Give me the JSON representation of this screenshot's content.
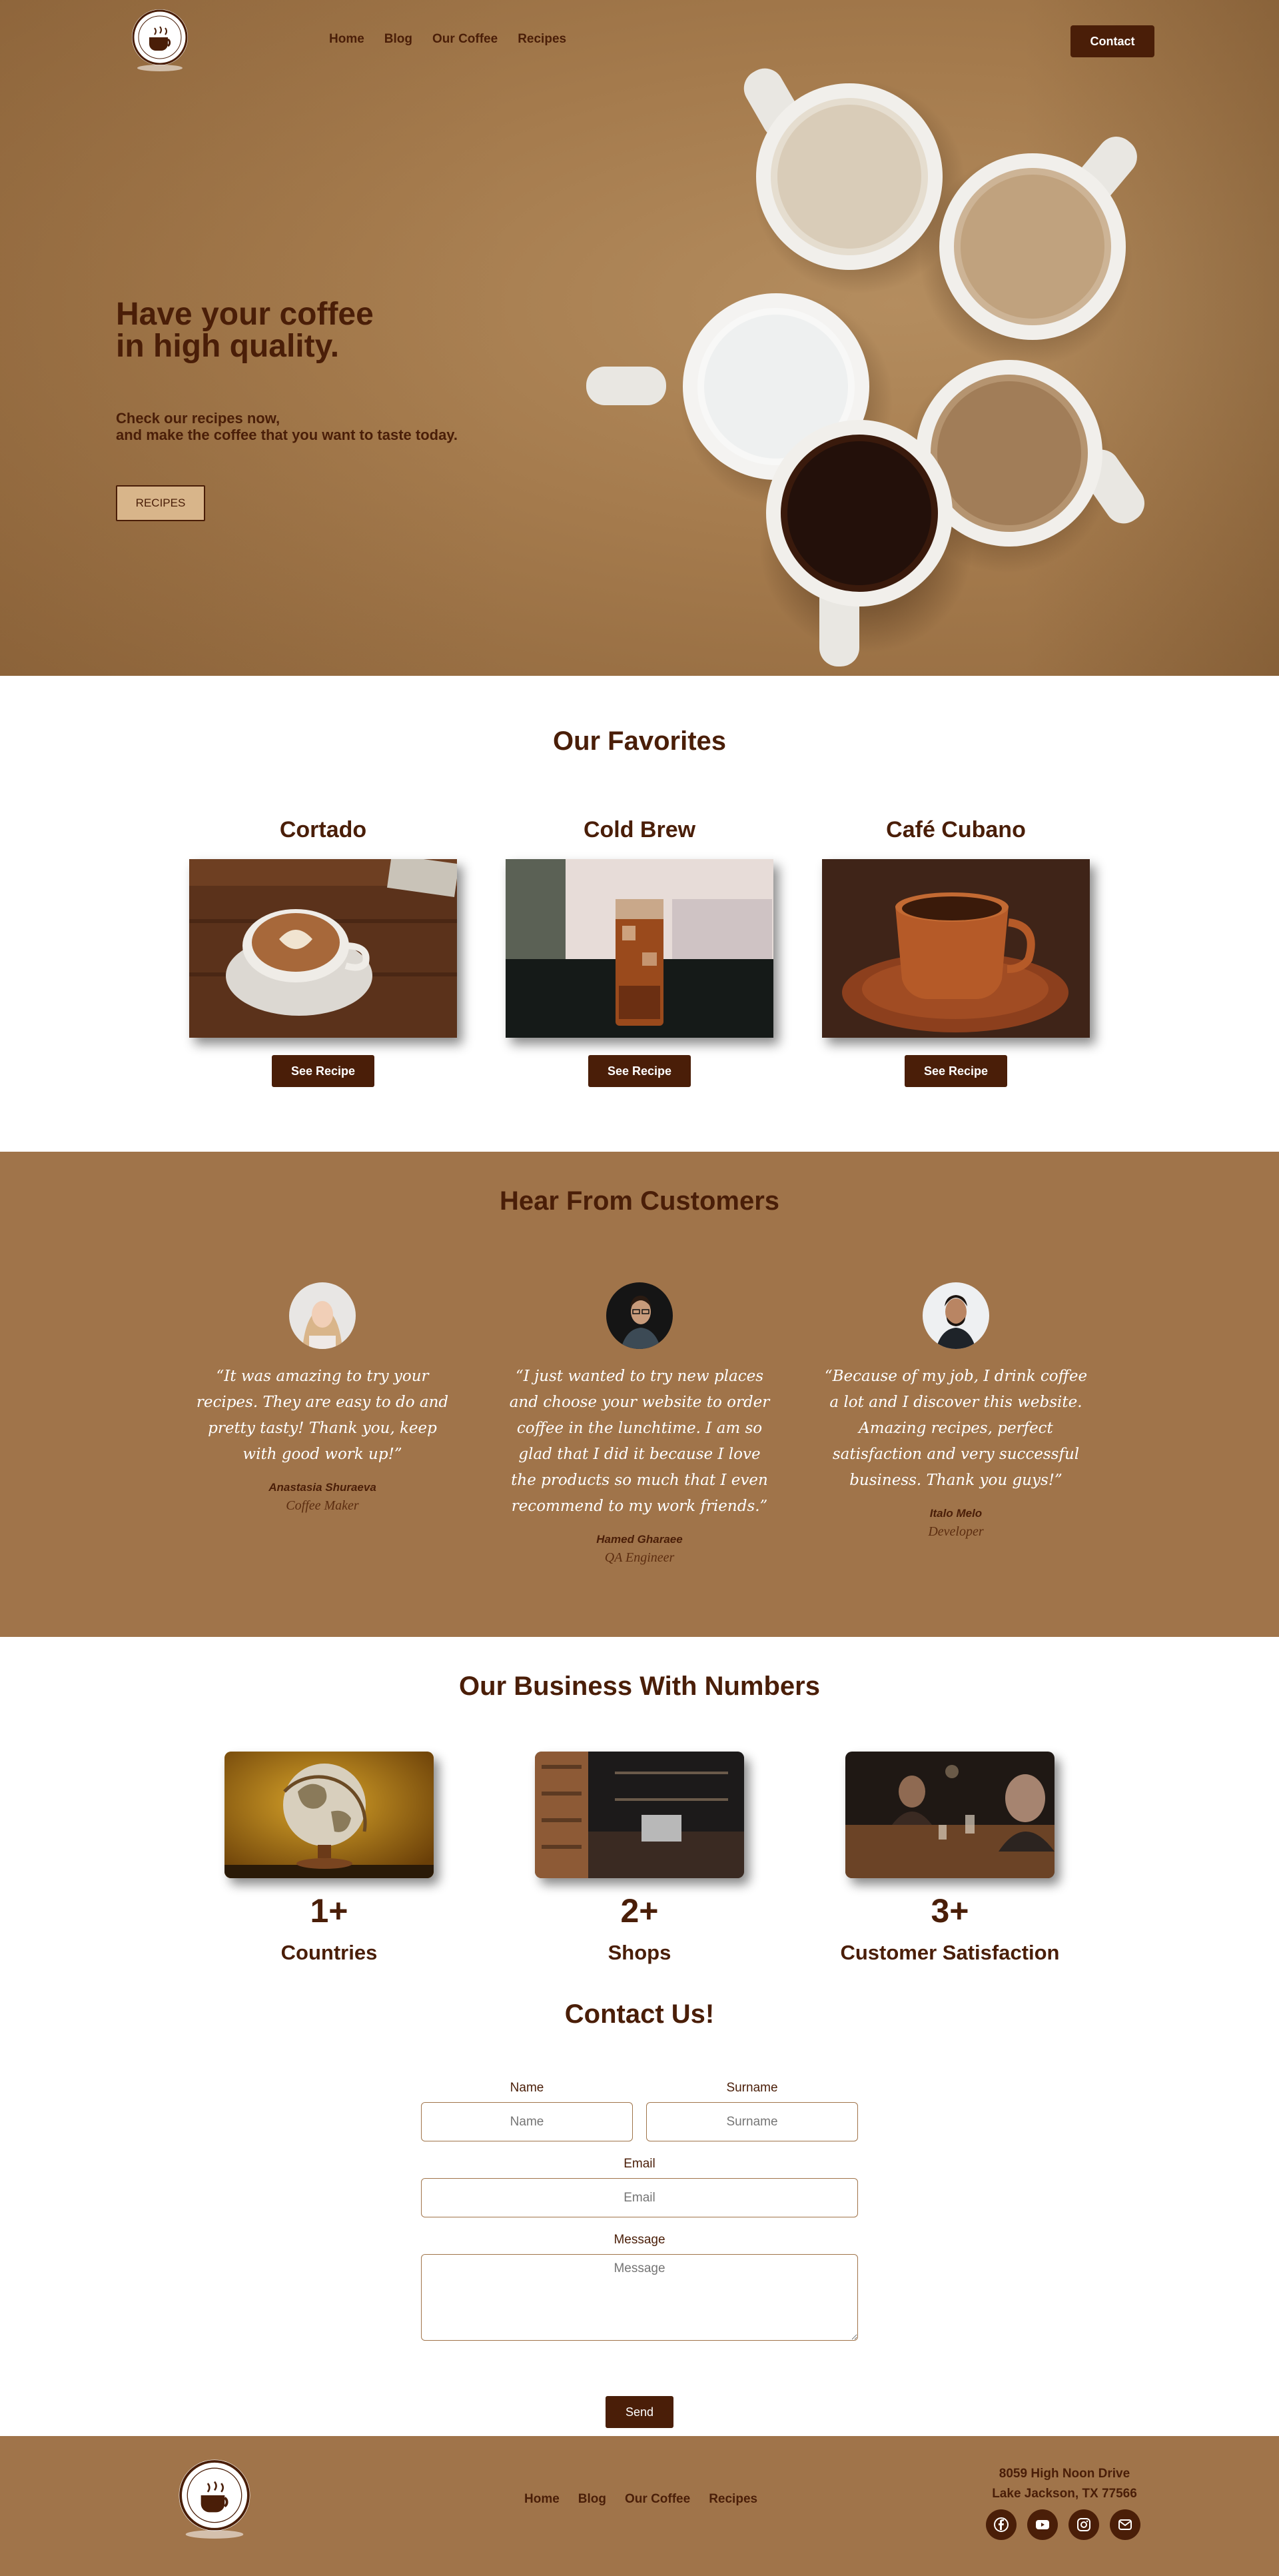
{
  "brand": {
    "logo_text": "COFFEE",
    "accent": "#4a1e08",
    "brown": "#a0744a"
  },
  "nav": {
    "links": [
      "Home",
      "Blog",
      "Our Coffee",
      "Recipes"
    ],
    "contact_label": "Contact"
  },
  "hero": {
    "title_line1": "Have your coffee",
    "title_line2": "in high quality.",
    "subtitle_line1": "Check our recipes now,",
    "subtitle_line2": "and make the coffee that you want to taste today.",
    "button_label": "RECIPES"
  },
  "favorites": {
    "title": "Our Favorites",
    "items": [
      {
        "name": "Cortado",
        "button": "See Recipe"
      },
      {
        "name": "Cold Brew",
        "button": "See Recipe"
      },
      {
        "name": "Café Cubano",
        "button": "See Recipe"
      }
    ]
  },
  "testimonials": {
    "title": "Hear From Customers",
    "items": [
      {
        "quote": "“It was amazing to try your recipes. They are easy to do and pretty tasty! Thank you, keep with good work up!”",
        "name": "Anastasia Shuraeva",
        "role": "Coffee Maker"
      },
      {
        "quote": "“I just wanted to try new places and choose your website to order coffee in the lunchtime. I am so glad that I did it because I love the products so much that I even recommend to my work friends.”",
        "name": "Hamed Gharaee",
        "role": "QA Engineer"
      },
      {
        "quote": "“Because of my job, I drink coffee a lot and I discover this website. Amazing recipes, perfect satisfaction and very successful business. Thank you guys!”",
        "name": "Italo Melo",
        "role": "Developer"
      }
    ]
  },
  "numbers": {
    "title": "Our Business With Numbers",
    "items": [
      {
        "value": "1+",
        "label": "Countries"
      },
      {
        "value": "2+",
        "label": "Shops"
      },
      {
        "value": "3+",
        "label": "Customer Satisfaction"
      }
    ]
  },
  "contact": {
    "title": "Contact Us!",
    "name_label": "Name",
    "name_placeholder": "Name",
    "surname_label": "Surname",
    "surname_placeholder": "Surname",
    "email_label": "Email",
    "email_placeholder": "Email",
    "message_label": "Message",
    "message_placeholder": "Message",
    "send_label": "Send"
  },
  "footer": {
    "links": [
      "Home",
      "Blog",
      "Our Coffee",
      "Recipes"
    ],
    "address_line1": "8059 High Noon Drive",
    "address_line2": "Lake Jackson, TX 77566",
    "socials": [
      "facebook-icon",
      "youtube-icon",
      "instagram-icon",
      "mail-icon"
    ]
  }
}
